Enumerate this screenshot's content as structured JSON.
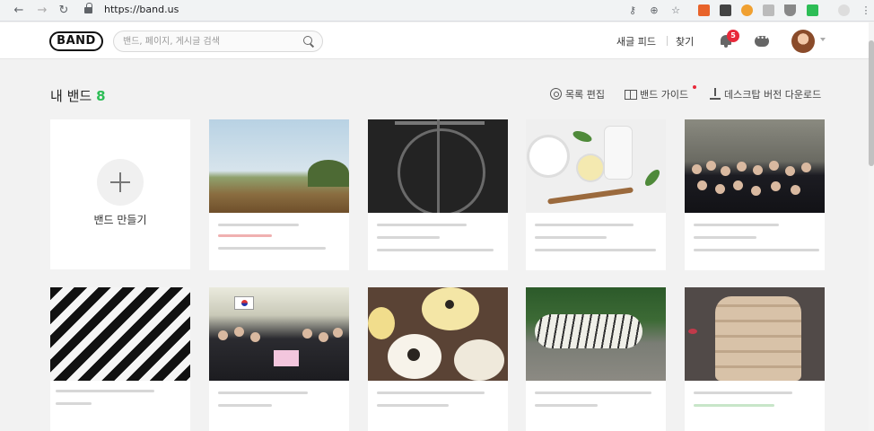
{
  "browser": {
    "url": "https://band.us",
    "back_icon": "back-arrow-icon",
    "forward_icon": "forward-arrow-icon",
    "reload_icon": "reload-icon"
  },
  "header": {
    "logo": "BAND",
    "search_placeholder": "밴드, 페이지, 게시글 검색",
    "new_feed": "새글 피드",
    "find": "찾기",
    "notification_count": "5"
  },
  "section": {
    "title": "내 밴드",
    "count": "8",
    "edit_list": "목록 편집",
    "band_guide": "밴드 가이드",
    "desktop_download": "데스크탑 버전 다운로드"
  },
  "create_card": {
    "label": "밴드 만들기"
  },
  "colors": {
    "accent_green": "#2dbd56",
    "badge_red": "#e8293a"
  }
}
